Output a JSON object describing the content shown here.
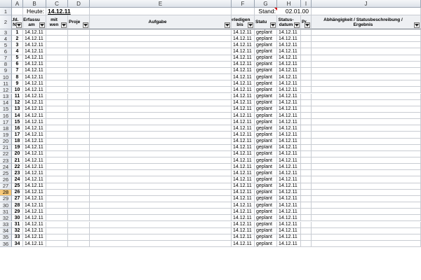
{
  "column_headers": [
    "A",
    "B",
    "C",
    "D",
    "E",
    "F",
    "G",
    "H",
    "I",
    "J"
  ],
  "row1": {
    "heute_label": "Heute:",
    "heute_value": "14.12.11",
    "stand_label": "Stand:",
    "stand_value": "02.01.00"
  },
  "table_headers": {
    "A": "Lfd.\nN",
    "B": "Erfassu\nam",
    "C": "mit\nwen",
    "D": "Proje",
    "E": "Aufgabe",
    "F": "erledigen\nbis",
    "G": "Statu",
    "H": "Status-\ndatum",
    "I": "Pr",
    "J": "Abhängigkeit / Statusbeschreibung /\nErgebnis"
  },
  "rows": [
    {
      "row": "3",
      "lfd": "1",
      "erfasst": "14.12.11",
      "erledigen": "14.12.11",
      "status": "geplant",
      "statusdatum": "14.12.11"
    },
    {
      "row": "4",
      "lfd": "2",
      "erfasst": "14.12.11",
      "erledigen": "14.12.11",
      "status": "geplant",
      "statusdatum": "14.12.11"
    },
    {
      "row": "5",
      "lfd": "3",
      "erfasst": "14.12.11",
      "erledigen": "14.12.11",
      "status": "geplant",
      "statusdatum": "14.12.11"
    },
    {
      "row": "6",
      "lfd": "4",
      "erfasst": "14.12.11",
      "erledigen": "14.12.11",
      "status": "geplant",
      "statusdatum": "14.12.11"
    },
    {
      "row": "7",
      "lfd": "5",
      "erfasst": "14.12.11",
      "erledigen": "14.12.11",
      "status": "geplant",
      "statusdatum": "14.12.11"
    },
    {
      "row": "8",
      "lfd": "6",
      "erfasst": "14.12.11",
      "erledigen": "14.12.11",
      "status": "geplant",
      "statusdatum": "14.12.11"
    },
    {
      "row": "9",
      "lfd": "7",
      "erfasst": "14.12.11",
      "erledigen": "14.12.11",
      "status": "geplant",
      "statusdatum": "14.12.11"
    },
    {
      "row": "10",
      "lfd": "8",
      "erfasst": "14.12.11",
      "erledigen": "14.12.11",
      "status": "geplant",
      "statusdatum": "14.12.11"
    },
    {
      "row": "11",
      "lfd": "9",
      "erfasst": "14.12.11",
      "erledigen": "14.12.11",
      "status": "geplant",
      "statusdatum": "14.12.11"
    },
    {
      "row": "12",
      "lfd": "10",
      "erfasst": "14.12.11",
      "erledigen": "14.12.11",
      "status": "geplant",
      "statusdatum": "14.12.11"
    },
    {
      "row": "13",
      "lfd": "11",
      "erfasst": "14.12.11",
      "erledigen": "14.12.11",
      "status": "geplant",
      "statusdatum": "14.12.11"
    },
    {
      "row": "14",
      "lfd": "12",
      "erfasst": "14.12.11",
      "erledigen": "14.12.11",
      "status": "geplant",
      "statusdatum": "14.12.11"
    },
    {
      "row": "15",
      "lfd": "13",
      "erfasst": "14.12.11",
      "erledigen": "14.12.11",
      "status": "geplant",
      "statusdatum": "14.12.11"
    },
    {
      "row": "16",
      "lfd": "14",
      "erfasst": "14.12.11",
      "erledigen": "14.12.11",
      "status": "geplant",
      "statusdatum": "14.12.11"
    },
    {
      "row": "17",
      "lfd": "15",
      "erfasst": "14.12.11",
      "erledigen": "14.12.11",
      "status": "geplant",
      "statusdatum": "14.12.11"
    },
    {
      "row": "18",
      "lfd": "16",
      "erfasst": "14.12.11",
      "erledigen": "14.12.11",
      "status": "geplant",
      "statusdatum": "14.12.11"
    },
    {
      "row": "19",
      "lfd": "17",
      "erfasst": "14.12.11",
      "erledigen": "14.12.11",
      "status": "geplant",
      "statusdatum": "14.12.11"
    },
    {
      "row": "20",
      "lfd": "18",
      "erfasst": "14.12.11",
      "erledigen": "14.12.11",
      "status": "geplant",
      "statusdatum": "14.12.11"
    },
    {
      "row": "21",
      "lfd": "19",
      "erfasst": "14.12.11",
      "erledigen": "14.12.11",
      "status": "geplant",
      "statusdatum": "14.12.11"
    },
    {
      "row": "22",
      "lfd": "20",
      "erfasst": "14.12.11",
      "erledigen": "14.12.11",
      "status": "geplant",
      "statusdatum": "14.12.11"
    },
    {
      "row": "23",
      "lfd": "21",
      "erfasst": "14.12.11",
      "erledigen": "14.12.11",
      "status": "geplant",
      "statusdatum": "14.12.11"
    },
    {
      "row": "24",
      "lfd": "22",
      "erfasst": "14.12.11",
      "erledigen": "14.12.11",
      "status": "geplant",
      "statusdatum": "14.12.11"
    },
    {
      "row": "25",
      "lfd": "23",
      "erfasst": "14.12.11",
      "erledigen": "14.12.11",
      "status": "geplant",
      "statusdatum": "14.12.11"
    },
    {
      "row": "26",
      "lfd": "24",
      "erfasst": "14.12.11",
      "erledigen": "14.12.11",
      "status": "geplant",
      "statusdatum": "14.12.11"
    },
    {
      "row": "27",
      "lfd": "25",
      "erfasst": "14.12.11",
      "erledigen": "14.12.11",
      "status": "geplant",
      "statusdatum": "14.12.11"
    },
    {
      "row": "28",
      "lfd": "26",
      "erfasst": "14.12.11",
      "erledigen": "14.12.11",
      "status": "geplant",
      "statusdatum": "14.12.11"
    },
    {
      "row": "29",
      "lfd": "27",
      "erfasst": "14.12.11",
      "erledigen": "14.12.11",
      "status": "geplant",
      "statusdatum": "14.12.11"
    },
    {
      "row": "30",
      "lfd": "28",
      "erfasst": "14.12.11",
      "erledigen": "14.12.11",
      "status": "geplant",
      "statusdatum": "14.12.11"
    },
    {
      "row": "31",
      "lfd": "29",
      "erfasst": "14.12.11",
      "erledigen": "14.12.11",
      "status": "geplant",
      "statusdatum": "14.12.11"
    },
    {
      "row": "32",
      "lfd": "30",
      "erfasst": "14.12.11",
      "erledigen": "14.12.11",
      "status": "geplant",
      "statusdatum": "14.12.11"
    },
    {
      "row": "33",
      "lfd": "31",
      "erfasst": "14.12.11",
      "erledigen": "14.12.11",
      "status": "geplant",
      "statusdatum": "14.12.11"
    },
    {
      "row": "34",
      "lfd": "32",
      "erfasst": "14.12.11",
      "erledigen": "14.12.11",
      "status": "geplant",
      "statusdatum": "14.12.11"
    },
    {
      "row": "35",
      "lfd": "33",
      "erfasst": "14.12.11",
      "erledigen": "14.12.11",
      "status": "geplant",
      "statusdatum": "14.12.11"
    }
  ],
  "partial_row": {
    "row": "36",
    "lfd": "34",
    "erfasst": "14.12.11",
    "erledigen": "14.12.11",
    "status": "geplant",
    "statusdatum": "14.12.11"
  },
  "selected_row": "28",
  "colors": {
    "header_bg": "#dde2e9",
    "selected_row_header": "#f7c97a",
    "gridline": "#c8ccd2",
    "comment_marker": "#d40000"
  },
  "icons": {
    "filter_dropdown": "filter-dropdown-icon",
    "comment_indicator": "comment-indicator-icon"
  }
}
